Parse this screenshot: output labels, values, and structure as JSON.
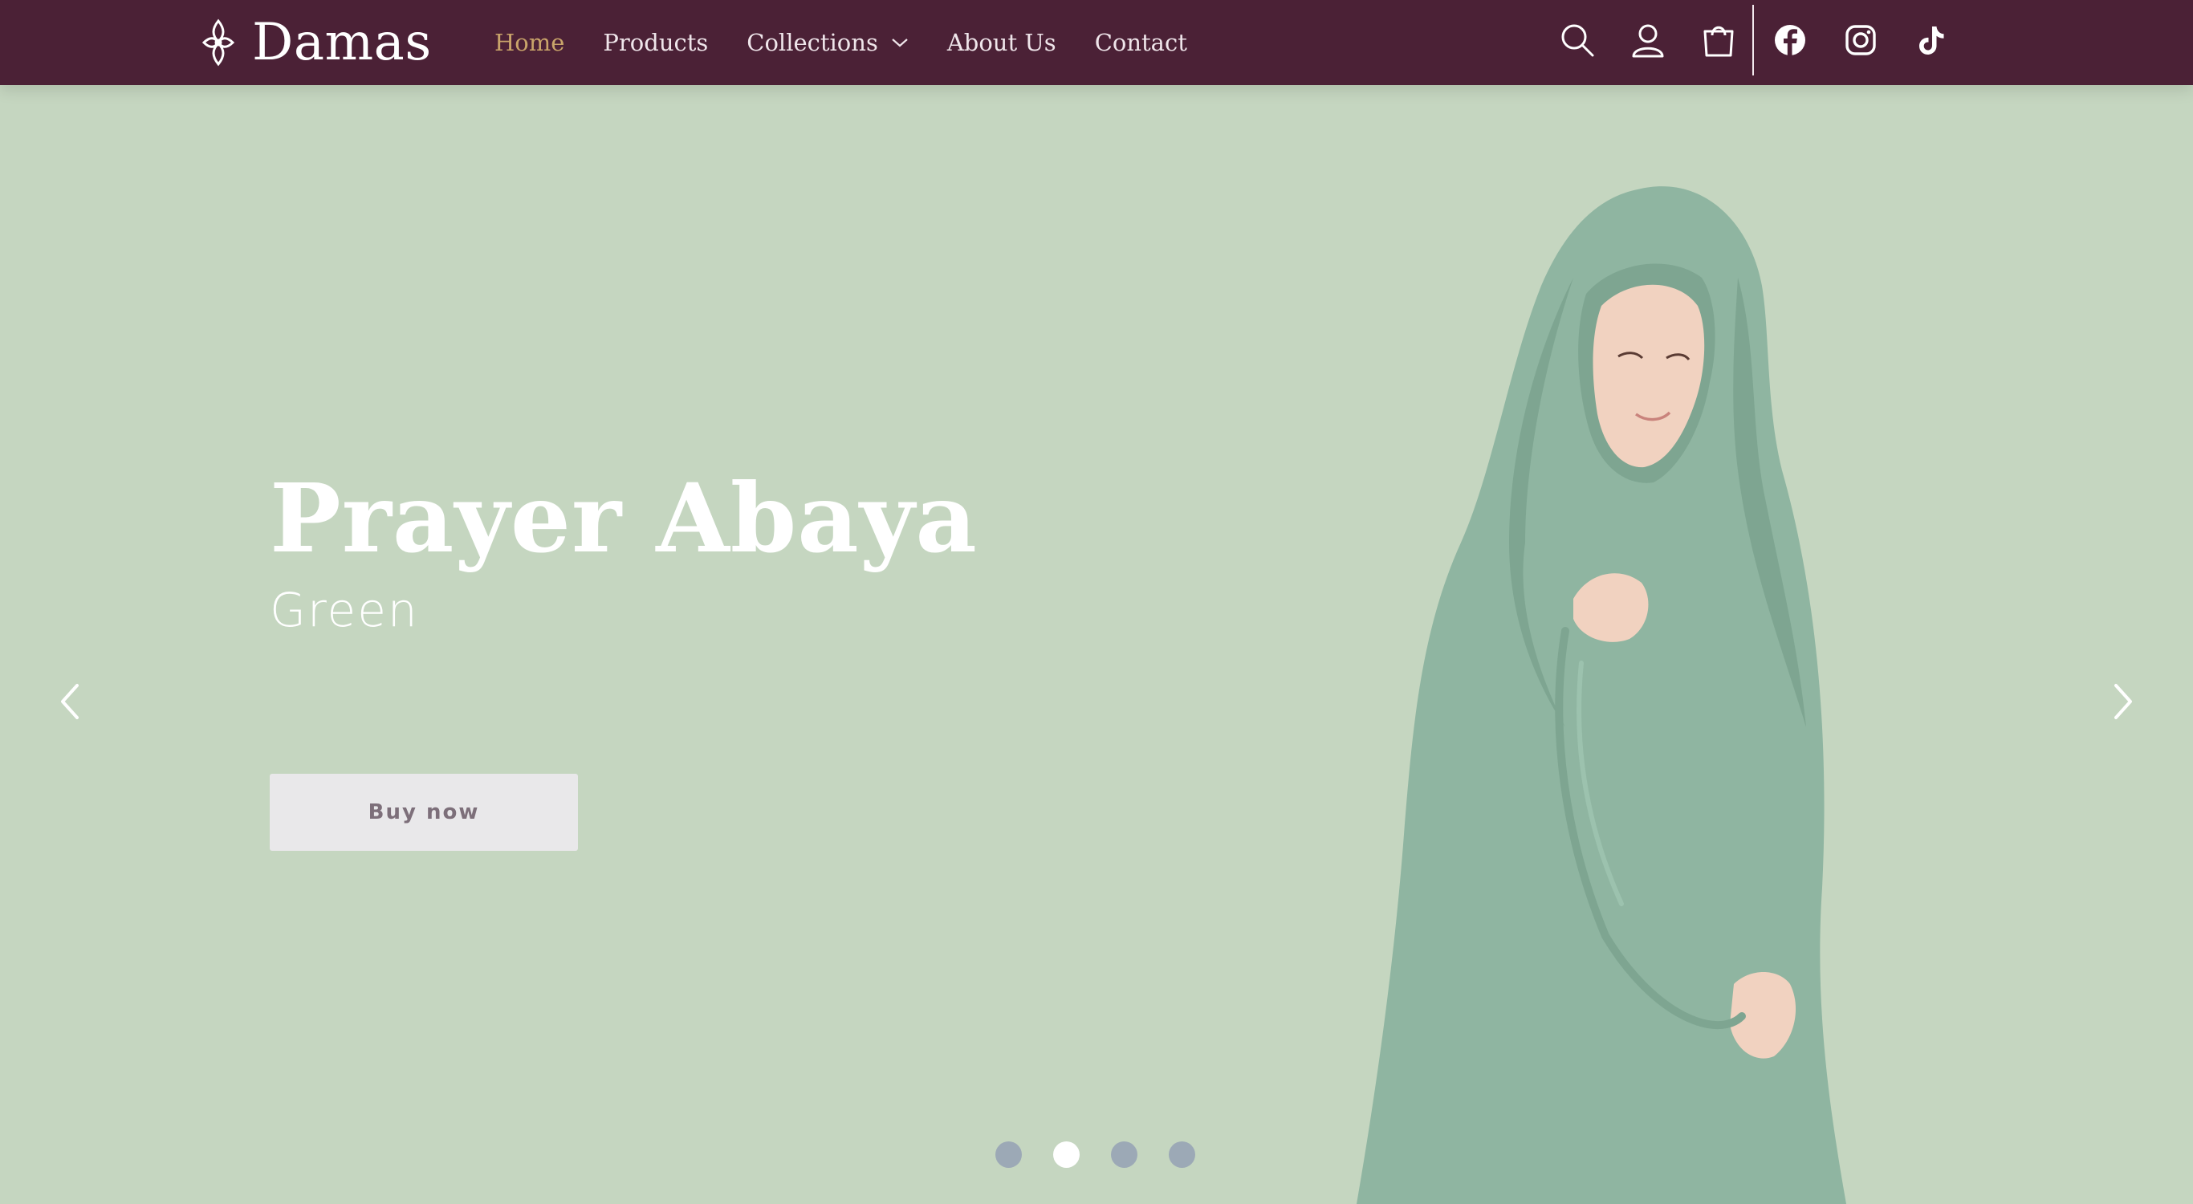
{
  "brand": {
    "name": "Damas",
    "logo_icon": "ornament-icon"
  },
  "nav": {
    "items": [
      {
        "label": "Home",
        "active": true
      },
      {
        "label": "Products",
        "active": false
      },
      {
        "label": "Collections",
        "active": false,
        "has_dropdown": true
      },
      {
        "label": "About Us",
        "active": false
      },
      {
        "label": "Contact",
        "active": false
      }
    ]
  },
  "header_icons": [
    "search-icon",
    "account-icon",
    "cart-icon",
    "facebook-icon",
    "instagram-icon",
    "tiktok-icon"
  ],
  "hero": {
    "title": "Prayer Abaya",
    "subtitle": "Green",
    "cta_label": "Buy now",
    "slides_total": 4,
    "active_slide": 2
  },
  "colors": {
    "header_bg": "#4b2136",
    "nav_active": "#c9a46a",
    "hero_bg": "#c5d6c0",
    "garment": "#8fb5a1",
    "button_bg": "#e9e8ea",
    "dot_inactive": "#9ca9b6",
    "dot_active": "#ffffff"
  }
}
